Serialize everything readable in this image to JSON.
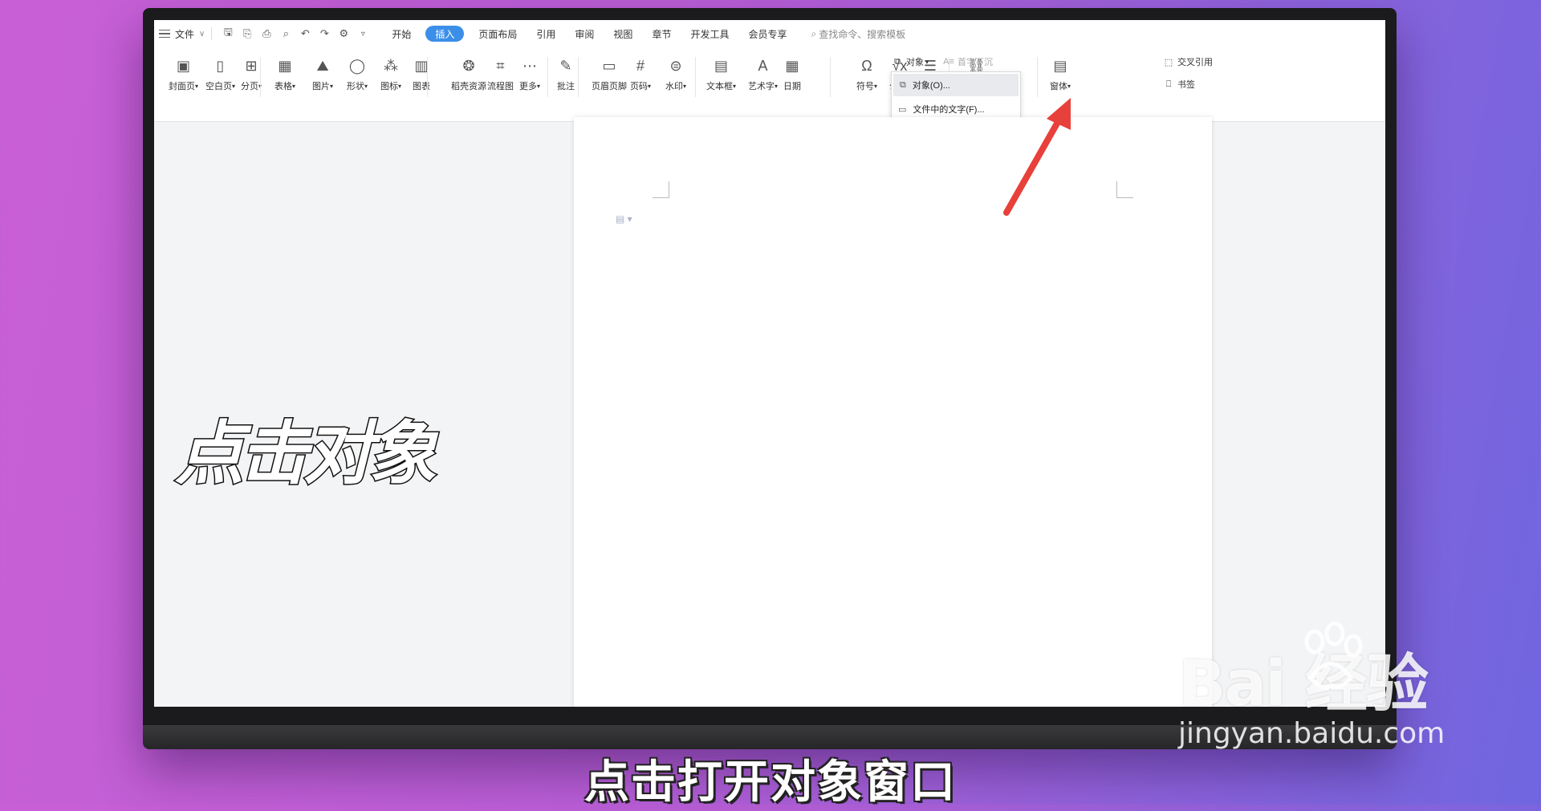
{
  "menubar": {
    "file_label": "文件",
    "tabs": [
      "开始",
      "插入",
      "页面布局",
      "引用",
      "审阅",
      "视图",
      "章节",
      "开发工具",
      "会员专享"
    ],
    "active_tab": "插入",
    "search_label": "查找命令、搜索模板"
  },
  "ribbon": {
    "groups": [
      {
        "label": "封面页",
        "caret": true
      },
      {
        "label": "空白页",
        "caret": true
      },
      {
        "label": "分页",
        "caret": true
      },
      {
        "label": "表格",
        "caret": true
      },
      {
        "label": "图片",
        "caret": true
      },
      {
        "label": "形状",
        "caret": true
      },
      {
        "label": "图标",
        "caret": true
      },
      {
        "label": "图表",
        "caret": false
      },
      {
        "label": "稻壳资源",
        "caret": false
      },
      {
        "label": "流程图",
        "caret": false
      },
      {
        "label": "更多",
        "caret": true
      },
      {
        "label": "批注",
        "caret": false
      },
      {
        "label": "页眉页脚",
        "caret": false
      },
      {
        "label": "页码",
        "caret": true
      },
      {
        "label": "水印",
        "caret": true
      },
      {
        "label": "文本框",
        "caret": true
      },
      {
        "label": "艺术字",
        "caret": true
      },
      {
        "label": "日期",
        "caret": false
      },
      {
        "label": "符号",
        "caret": true
      },
      {
        "label": "公式",
        "caret": true
      },
      {
        "label": "编号",
        "caret": false
      },
      {
        "label": "超链接",
        "caret": false
      },
      {
        "label": "窗体",
        "caret": true
      }
    ],
    "object_label": "对象",
    "drop_cap_label": "首字下沉",
    "cross_ref_label": "交叉引用",
    "bookmark_label": "书签"
  },
  "dropdown": {
    "items": [
      "对象(O)...",
      "文件中的文字(F)..."
    ]
  },
  "overlay": {
    "left_caption": "点击对象",
    "subtitle": "点击打开对象窗口"
  },
  "watermark": {
    "logo": "Bai  经验",
    "url": "jingyan.baidu.com"
  },
  "colors": {
    "accent": "#3b8fe8",
    "arrow": "#e8403a"
  }
}
